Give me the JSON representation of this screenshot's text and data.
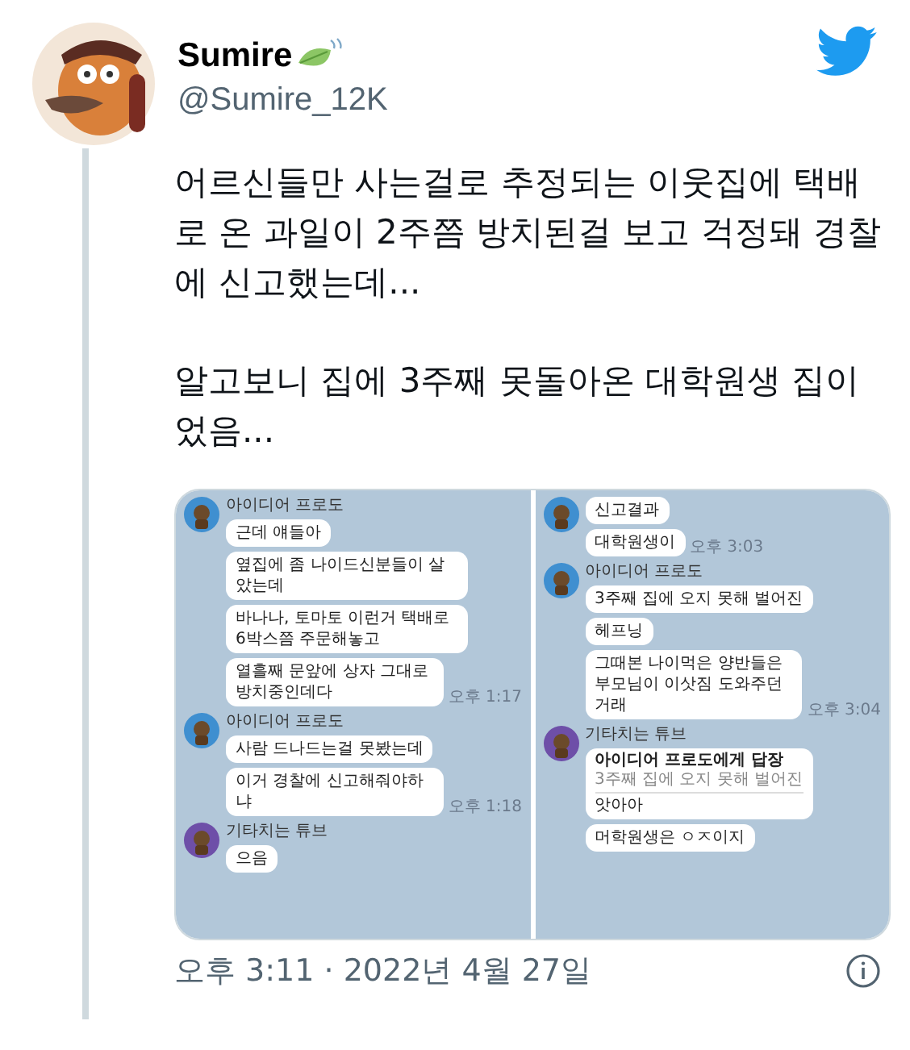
{
  "tweet": {
    "author": {
      "name": "Sumire",
      "handle": "@Sumire_12K"
    },
    "paragraphs": [
      "어르신들만 사는걸로 추정되는 이웃집에 택배로 온 과일이 2주쯤 방치된걸 보고 걱정돼 경찰에 신고했는데...",
      "알고보니 집에 3주째 못돌아온 대학원생 집이었음..."
    ],
    "image_panels": [
      {
        "groups": [
          {
            "sender": "아이디어 프로도",
            "color": "#3f8fd0",
            "messages": [
              {
                "kind": "text",
                "text": "근데 얘들아"
              },
              {
                "kind": "text",
                "text": "옆집에 좀 나이드신분들이 살았는데"
              },
              {
                "kind": "text",
                "text": "바나나, 토마토 이런거 택배로 6박스쯤 주문해놓고"
              },
              {
                "kind": "text",
                "text": "열흘째 문앞에 상자 그대로 방치중인데다",
                "time": "오후 1:17"
              }
            ]
          },
          {
            "sender": "아이디어 프로도",
            "color": "#3f8fd0",
            "messages": [
              {
                "kind": "text",
                "text": "사람 드나드는걸 못봤는데"
              },
              {
                "kind": "text",
                "text": "이거 경찰에 신고해줘야하냐",
                "time": "오후 1:18"
              }
            ]
          },
          {
            "sender": "기타치는 튜브",
            "color": "#6e4fa8",
            "messages": [
              {
                "kind": "text",
                "text": "으음"
              }
            ]
          }
        ]
      },
      {
        "groups": [
          {
            "color": "#3f8fd0",
            "messages": [
              {
                "kind": "text",
                "text": "신고결과"
              },
              {
                "kind": "text",
                "text": "대학원생이",
                "time": "오후 3:03"
              }
            ]
          },
          {
            "sender": "아이디어 프로도",
            "color": "#3f8fd0",
            "messages": [
              {
                "kind": "text",
                "text": "3주째 집에 오지 못해 벌어진"
              },
              {
                "kind": "text",
                "text": "헤프닝"
              },
              {
                "kind": "text",
                "text": "그때본 나이먹은 양반들은 부모님이 이삿짐 도와주던거래",
                "time": "오후 3:04"
              }
            ]
          },
          {
            "sender": "기타치는 튜브",
            "color": "#6e4fa8",
            "messages": [
              {
                "kind": "reply",
                "reply_to": "아이디어 프로도에게 답장",
                "quote": "3주째 집에 오지 못해 벌어진",
                "text": "앗아아"
              },
              {
                "kind": "text",
                "text": "머학원생은 ㅇㅈ이지"
              }
            ]
          }
        ]
      }
    ],
    "timestamp": "오후 3:11 · 2022년 4월 27일"
  }
}
